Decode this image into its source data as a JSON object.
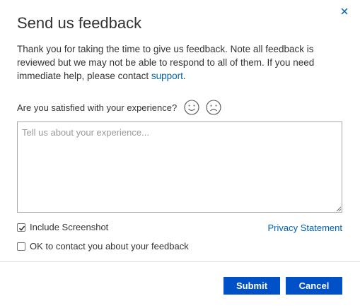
{
  "dialog": {
    "title": "Send us feedback",
    "intro_text": "Thank you for taking the time to give us feedback. Note all feedback is reviewed but we may not be able to respond to all of them. If you need immediate help, please contact ",
    "intro_link": "support",
    "intro_end": "."
  },
  "satisfaction": {
    "question": "Are you satisfied with your experience?"
  },
  "feedback": {
    "value": "",
    "placeholder": "Tell us about your experience..."
  },
  "options": {
    "include_screenshot_label": "Include Screenshot",
    "include_screenshot_checked": true,
    "contact_label": "OK to contact you about your feedback",
    "contact_checked": false,
    "privacy_link": "Privacy Statement"
  },
  "buttons": {
    "submit": "Submit",
    "cancel": "Cancel"
  },
  "colors": {
    "accent": "#0050c8",
    "link": "#0063b1"
  }
}
